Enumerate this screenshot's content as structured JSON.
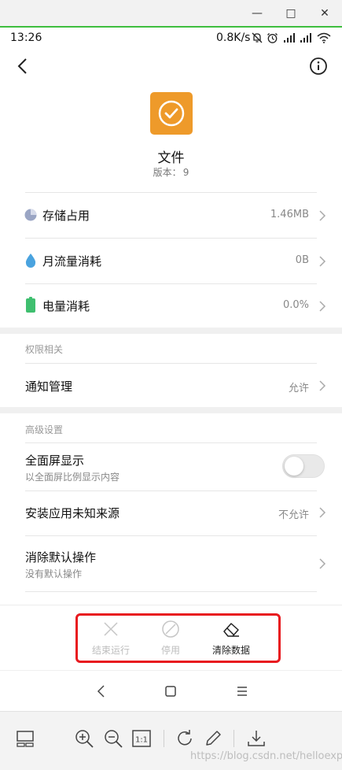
{
  "window": {
    "minimize_glyph": "—",
    "maximize_glyph": "□",
    "close_glyph": "✕"
  },
  "status_bar": {
    "time": "13:26",
    "net_speed": "0.8K/s",
    "icons": [
      "mute-bell-icon",
      "alarm-icon",
      "signal-icon",
      "signal-icon",
      "wifi-icon"
    ]
  },
  "header": {
    "back_icon": "chevron-left-icon",
    "info_icon": "info-circle-icon"
  },
  "app": {
    "name": "文件",
    "version_label": "版本：",
    "version": "9",
    "icon_color": "#ee9a2a"
  },
  "usage": [
    {
      "label": "存储占用",
      "value": "1.46MB",
      "icon": "pie-chart-icon"
    },
    {
      "label": "月流量消耗",
      "value": "0B",
      "icon": "water-drop-icon"
    },
    {
      "label": "电量消耗",
      "value": "0.0%",
      "icon": "battery-icon"
    }
  ],
  "permissions": {
    "section_title": "权限相关",
    "notification": {
      "label": "通知管理",
      "value": "允许"
    }
  },
  "advanced": {
    "section_title": "高级设置",
    "fullscreen": {
      "label": "全面屏显示",
      "sub": "以全面屏比例显示内容",
      "enabled": false
    },
    "unknown_sources": {
      "label": "安装应用未知来源",
      "value": "不允许"
    },
    "clear_defaults": {
      "label": "消除默认操作",
      "sub": "没有默认操作"
    }
  },
  "actions": [
    {
      "label": "结束运行",
      "icon": "close-x-icon",
      "enabled": false
    },
    {
      "label": "停用",
      "icon": "disable-circle-icon",
      "enabled": false
    },
    {
      "label": "清除数据",
      "icon": "eraser-icon",
      "enabled": true
    }
  ],
  "nav": [
    "back-triangle-icon",
    "home-square-icon",
    "menu-lines-icon"
  ],
  "viewer_toolbar": [
    "thumbnail-icon",
    "zoom-in-icon",
    "zoom-out-icon",
    "actual-size-icon",
    "rotate-icon",
    "edit-pencil-icon",
    "download-icon"
  ],
  "viewer_actual_size_label": "1:1",
  "watermark": "https://blog.csdn.net/helloexp",
  "colors": {
    "highlight_box": "#e8191f",
    "accent_green": "#3ebe3e",
    "disabled_text": "#bdbdbd"
  }
}
